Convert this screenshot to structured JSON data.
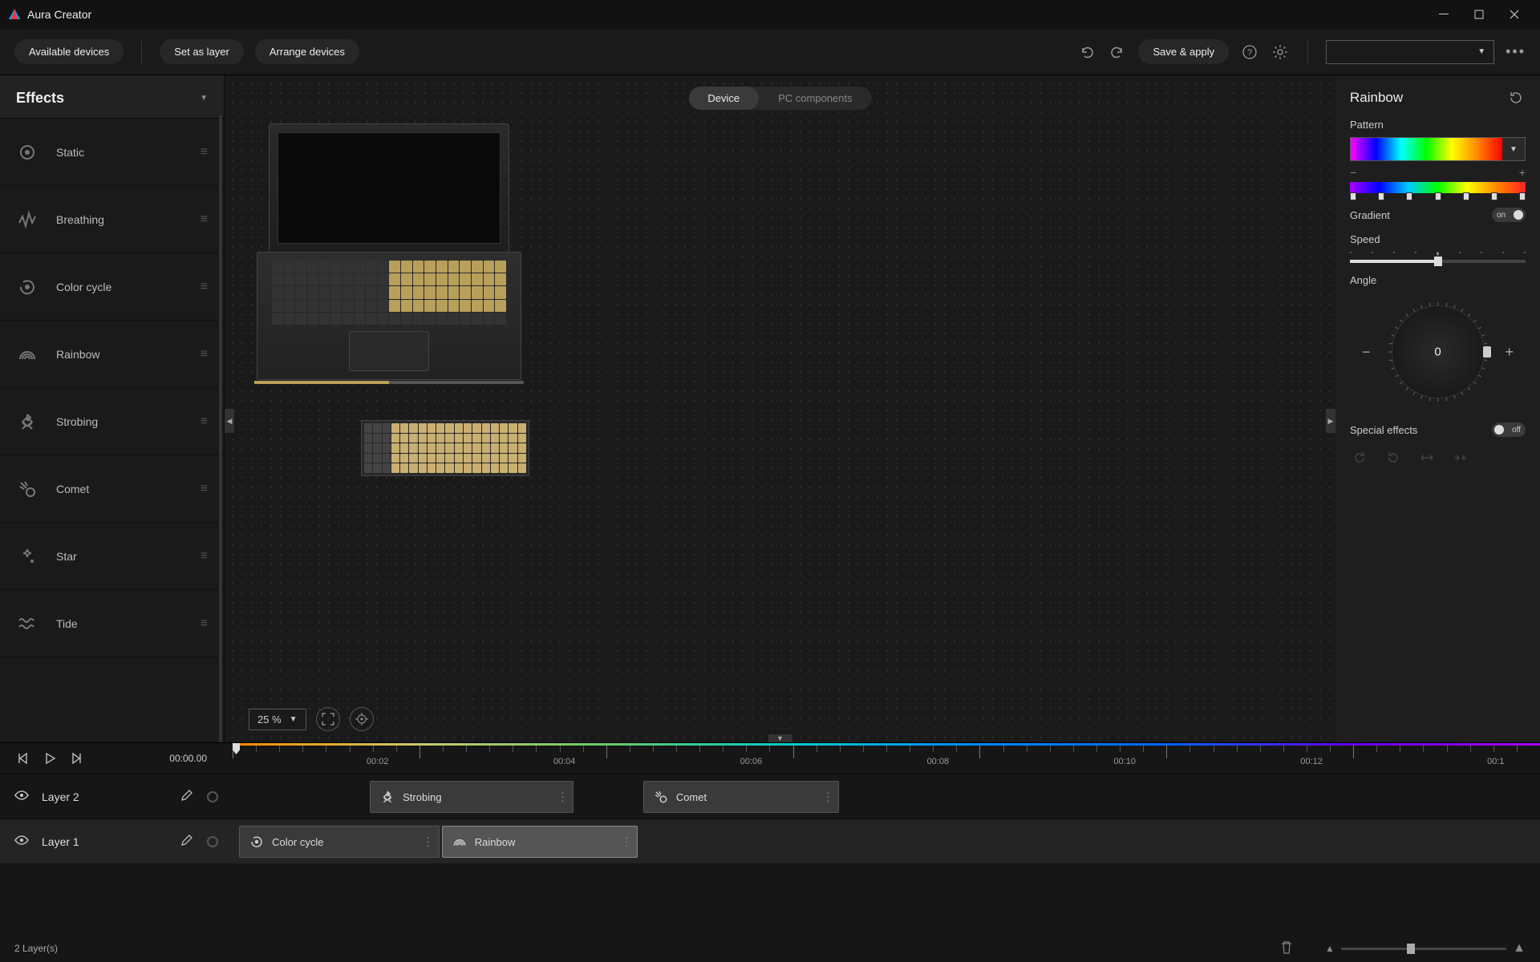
{
  "app": {
    "title": "Aura Creator"
  },
  "toolbar": {
    "available_devices": "Available devices",
    "set_as_layer": "Set as layer",
    "arrange_devices": "Arrange devices",
    "save_apply": "Save & apply"
  },
  "sidebar": {
    "title": "Effects",
    "items": [
      {
        "name": "Static"
      },
      {
        "name": "Breathing"
      },
      {
        "name": "Color cycle"
      },
      {
        "name": "Rainbow"
      },
      {
        "name": "Strobing"
      },
      {
        "name": "Comet"
      },
      {
        "name": "Star"
      },
      {
        "name": "Tide"
      }
    ]
  },
  "canvas": {
    "tabs": {
      "device": "Device",
      "pc": "PC components"
    },
    "zoom": "25 %"
  },
  "props": {
    "title": "Rainbow",
    "pattern_label": "Pattern",
    "gradient_label": "Gradient",
    "gradient_state": "on",
    "speed_label": "Speed",
    "speed_pct": 50,
    "angle_label": "Angle",
    "angle_value": "0",
    "special_label": "Special effects",
    "special_state": "off"
  },
  "timeline": {
    "current": "00:00.00",
    "marks": [
      "00:02",
      "00:04",
      "00:06",
      "00:08",
      "00:10",
      "00:12",
      "00:1"
    ],
    "layers": [
      {
        "name": "Layer 2",
        "clips": [
          {
            "effect": "Strobing",
            "start_pct": 10.5,
            "width_pct": 15.6
          },
          {
            "effect": "Comet",
            "start_pct": 31.4,
            "width_pct": 15.0
          }
        ]
      },
      {
        "name": "Layer 1",
        "clips": [
          {
            "effect": "Color cycle",
            "start_pct": 0.5,
            "width_pct": 15.3
          },
          {
            "effect": "Rainbow",
            "start_pct": 16.0,
            "width_pct": 15.0,
            "selected": true
          }
        ]
      }
    ],
    "layer_count_label": "2  Layer(s)"
  }
}
